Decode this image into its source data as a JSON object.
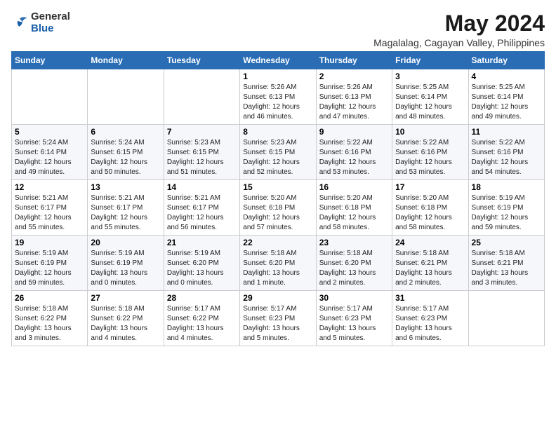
{
  "logo": {
    "text_general": "General",
    "text_blue": "Blue"
  },
  "header": {
    "month_year": "May 2024",
    "location": "Magalalag, Cagayan Valley, Philippines"
  },
  "weekdays": [
    "Sunday",
    "Monday",
    "Tuesday",
    "Wednesday",
    "Thursday",
    "Friday",
    "Saturday"
  ],
  "weeks": [
    [
      {
        "day": "",
        "info": ""
      },
      {
        "day": "",
        "info": ""
      },
      {
        "day": "",
        "info": ""
      },
      {
        "day": "1",
        "info": "Sunrise: 5:26 AM\nSunset: 6:13 PM\nDaylight: 12 hours\nand 46 minutes."
      },
      {
        "day": "2",
        "info": "Sunrise: 5:26 AM\nSunset: 6:13 PM\nDaylight: 12 hours\nand 47 minutes."
      },
      {
        "day": "3",
        "info": "Sunrise: 5:25 AM\nSunset: 6:14 PM\nDaylight: 12 hours\nand 48 minutes."
      },
      {
        "day": "4",
        "info": "Sunrise: 5:25 AM\nSunset: 6:14 PM\nDaylight: 12 hours\nand 49 minutes."
      }
    ],
    [
      {
        "day": "5",
        "info": "Sunrise: 5:24 AM\nSunset: 6:14 PM\nDaylight: 12 hours\nand 49 minutes."
      },
      {
        "day": "6",
        "info": "Sunrise: 5:24 AM\nSunset: 6:15 PM\nDaylight: 12 hours\nand 50 minutes."
      },
      {
        "day": "7",
        "info": "Sunrise: 5:23 AM\nSunset: 6:15 PM\nDaylight: 12 hours\nand 51 minutes."
      },
      {
        "day": "8",
        "info": "Sunrise: 5:23 AM\nSunset: 6:15 PM\nDaylight: 12 hours\nand 52 minutes."
      },
      {
        "day": "9",
        "info": "Sunrise: 5:22 AM\nSunset: 6:16 PM\nDaylight: 12 hours\nand 53 minutes."
      },
      {
        "day": "10",
        "info": "Sunrise: 5:22 AM\nSunset: 6:16 PM\nDaylight: 12 hours\nand 53 minutes."
      },
      {
        "day": "11",
        "info": "Sunrise: 5:22 AM\nSunset: 6:16 PM\nDaylight: 12 hours\nand 54 minutes."
      }
    ],
    [
      {
        "day": "12",
        "info": "Sunrise: 5:21 AM\nSunset: 6:17 PM\nDaylight: 12 hours\nand 55 minutes."
      },
      {
        "day": "13",
        "info": "Sunrise: 5:21 AM\nSunset: 6:17 PM\nDaylight: 12 hours\nand 55 minutes."
      },
      {
        "day": "14",
        "info": "Sunrise: 5:21 AM\nSunset: 6:17 PM\nDaylight: 12 hours\nand 56 minutes."
      },
      {
        "day": "15",
        "info": "Sunrise: 5:20 AM\nSunset: 6:18 PM\nDaylight: 12 hours\nand 57 minutes."
      },
      {
        "day": "16",
        "info": "Sunrise: 5:20 AM\nSunset: 6:18 PM\nDaylight: 12 hours\nand 58 minutes."
      },
      {
        "day": "17",
        "info": "Sunrise: 5:20 AM\nSunset: 6:18 PM\nDaylight: 12 hours\nand 58 minutes."
      },
      {
        "day": "18",
        "info": "Sunrise: 5:19 AM\nSunset: 6:19 PM\nDaylight: 12 hours\nand 59 minutes."
      }
    ],
    [
      {
        "day": "19",
        "info": "Sunrise: 5:19 AM\nSunset: 6:19 PM\nDaylight: 12 hours\nand 59 minutes."
      },
      {
        "day": "20",
        "info": "Sunrise: 5:19 AM\nSunset: 6:19 PM\nDaylight: 13 hours\nand 0 minutes."
      },
      {
        "day": "21",
        "info": "Sunrise: 5:19 AM\nSunset: 6:20 PM\nDaylight: 13 hours\nand 0 minutes."
      },
      {
        "day": "22",
        "info": "Sunrise: 5:18 AM\nSunset: 6:20 PM\nDaylight: 13 hours\nand 1 minute."
      },
      {
        "day": "23",
        "info": "Sunrise: 5:18 AM\nSunset: 6:20 PM\nDaylight: 13 hours\nand 2 minutes."
      },
      {
        "day": "24",
        "info": "Sunrise: 5:18 AM\nSunset: 6:21 PM\nDaylight: 13 hours\nand 2 minutes."
      },
      {
        "day": "25",
        "info": "Sunrise: 5:18 AM\nSunset: 6:21 PM\nDaylight: 13 hours\nand 3 minutes."
      }
    ],
    [
      {
        "day": "26",
        "info": "Sunrise: 5:18 AM\nSunset: 6:22 PM\nDaylight: 13 hours\nand 3 minutes."
      },
      {
        "day": "27",
        "info": "Sunrise: 5:18 AM\nSunset: 6:22 PM\nDaylight: 13 hours\nand 4 minutes."
      },
      {
        "day": "28",
        "info": "Sunrise: 5:17 AM\nSunset: 6:22 PM\nDaylight: 13 hours\nand 4 minutes."
      },
      {
        "day": "29",
        "info": "Sunrise: 5:17 AM\nSunset: 6:23 PM\nDaylight: 13 hours\nand 5 minutes."
      },
      {
        "day": "30",
        "info": "Sunrise: 5:17 AM\nSunset: 6:23 PM\nDaylight: 13 hours\nand 5 minutes."
      },
      {
        "day": "31",
        "info": "Sunrise: 5:17 AM\nSunset: 6:23 PM\nDaylight: 13 hours\nand 6 minutes."
      },
      {
        "day": "",
        "info": ""
      }
    ]
  ]
}
